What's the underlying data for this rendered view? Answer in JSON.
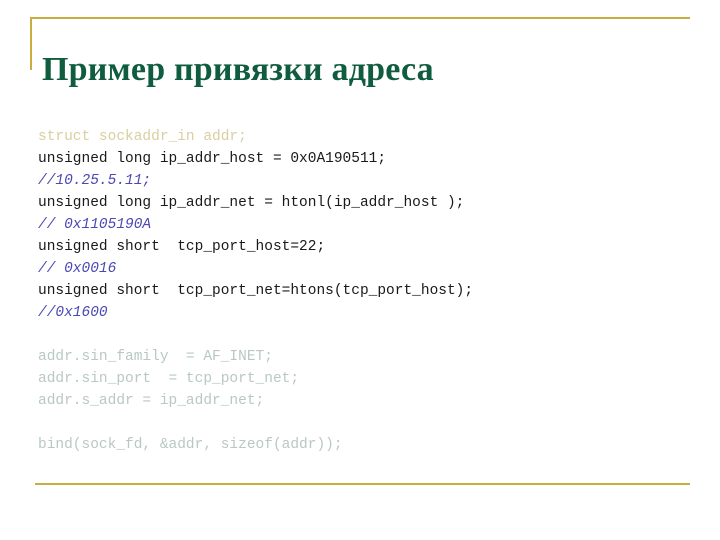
{
  "slide": {
    "title": "Пример привязки адреса",
    "accent_color": "#c9ad3f",
    "title_color": "#0f5c3f",
    "background_color": "#ffffff",
    "code_colors": {
      "tan": "#d9cfa0",
      "dark": "#1a1a1a",
      "comment": "#4b48b4",
      "pale": "#b9c9c1"
    },
    "code_lines": [
      {
        "text": "struct sockaddr_in addr;",
        "style": "tan"
      },
      {
        "text": "unsigned long ip_addr_host = 0x0A190511;",
        "style": "dark"
      },
      {
        "text": "//10.25.5.11;",
        "style": "comment"
      },
      {
        "text": "unsigned long ip_addr_net = htonl(ip_addr_host );",
        "style": "dark"
      },
      {
        "text": "// 0x1105190A",
        "style": "comment"
      },
      {
        "text": "unsigned short  tcp_port_host=22;",
        "style": "dark"
      },
      {
        "text": "// 0x0016",
        "style": "comment"
      },
      {
        "text": "unsigned short  tcp_port_net=htons(tcp_port_host);",
        "style": "dark"
      },
      {
        "text": "//0x1600",
        "style": "comment"
      },
      {
        "text": "",
        "style": "blank"
      },
      {
        "text": "addr.sin_family  = AF_INET;",
        "style": "pale"
      },
      {
        "text": "addr.sin_port  = tcp_port_net;",
        "style": "pale"
      },
      {
        "text": "addr.s_addr = ip_addr_net;",
        "style": "pale"
      },
      {
        "text": "",
        "style": "blank"
      },
      {
        "text": "bind(sock_fd, &addr, sizeof(addr));",
        "style": "pale"
      }
    ]
  }
}
